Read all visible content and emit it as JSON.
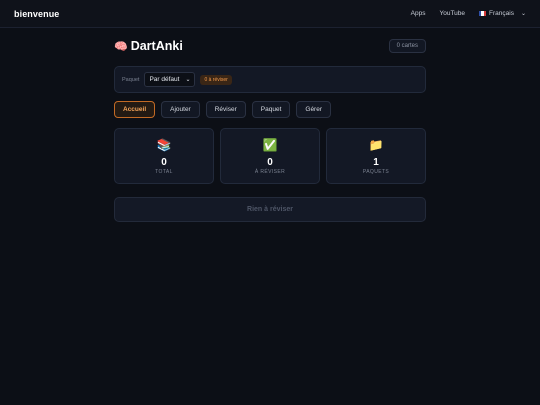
{
  "nav": {
    "brand": "bienvenue",
    "links": [
      "Apps",
      "YouTube"
    ],
    "language": "Français"
  },
  "app": {
    "title": "DartAnki",
    "card_count": "0 cartes"
  },
  "deck": {
    "label": "Paquet",
    "selected": "Par défaut",
    "due_badge": "0 à réviser"
  },
  "tabs": [
    "Accueil",
    "Ajouter",
    "Réviser",
    "Paquet",
    "Gérer"
  ],
  "active_tab": "Accueil",
  "stats": [
    {
      "icon": "books-icon",
      "glyph": "📚",
      "value": "0",
      "label": "TOTAL"
    },
    {
      "icon": "check-mark-icon",
      "glyph": "✅",
      "value": "0",
      "label": "À RÉVISER"
    },
    {
      "icon": "folder-icon",
      "glyph": "📁",
      "value": "1",
      "label": "PAQUETS"
    }
  ],
  "review_button": "Rien à réviser",
  "colors": {
    "accent": "#f5a55a",
    "background": "#0c0f16",
    "panel": "#131825"
  }
}
